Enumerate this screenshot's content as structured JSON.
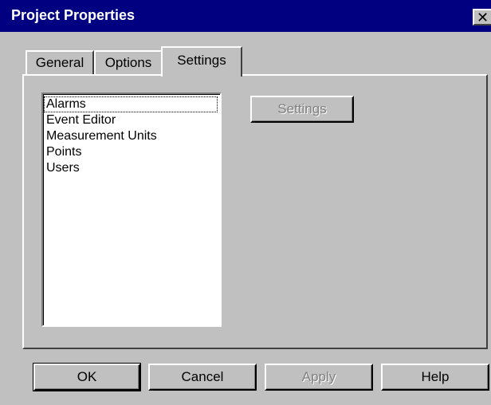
{
  "window": {
    "title": "Project Properties",
    "close_glyph": "✕",
    "colors": {
      "titlebar": "#000080",
      "face": "#c0c0c0",
      "disabled_text": "#808080"
    }
  },
  "tabs": [
    {
      "label": "General",
      "selected": false
    },
    {
      "label": "Options",
      "selected": false
    },
    {
      "label": "Settings",
      "selected": true
    }
  ],
  "settings_panel": {
    "list_items": [
      {
        "label": "Alarms",
        "focused": true
      },
      {
        "label": "Event Editor",
        "focused": false
      },
      {
        "label": "Measurement Units",
        "focused": false
      },
      {
        "label": "Points",
        "focused": false
      },
      {
        "label": "Users",
        "focused": false
      }
    ],
    "settings_button": {
      "label": "Settings",
      "enabled": false
    }
  },
  "footer": {
    "ok_label": "OK",
    "cancel_label": "Cancel",
    "apply_label": "Apply",
    "apply_enabled": false,
    "help_label": "Help"
  }
}
